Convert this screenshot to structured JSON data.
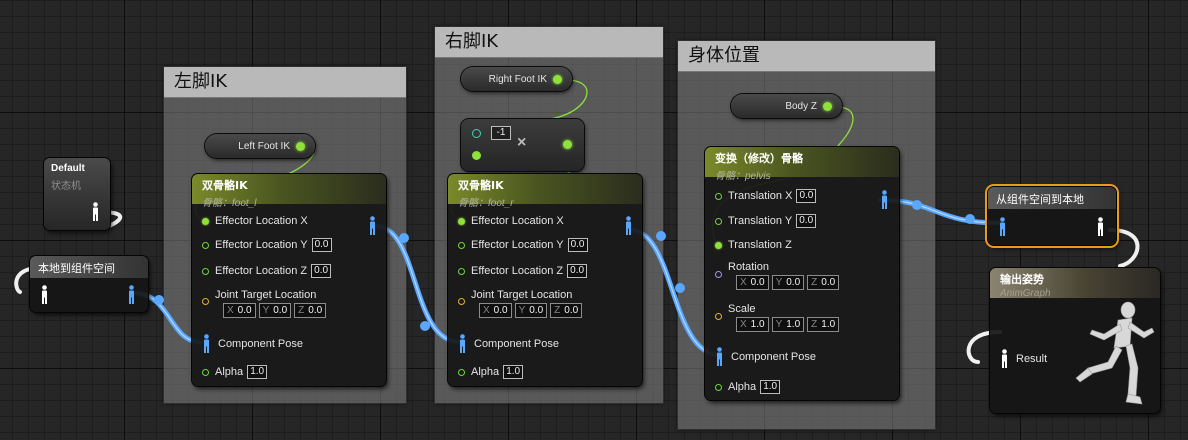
{
  "comments": [
    {
      "title": "左脚IK"
    },
    {
      "title": "右脚IK"
    },
    {
      "title": "身体位置"
    }
  ],
  "state_node": {
    "title": "Default",
    "subtitle": "状态机"
  },
  "local_to_component": {
    "title": "本地到组件空间"
  },
  "component_to_local": {
    "title": "从组件空间到本地"
  },
  "left_foot_get": {
    "label": "Left Foot IK"
  },
  "right_foot_get": {
    "label": "Right Foot IK"
  },
  "body_z_get": {
    "label": "Body Z"
  },
  "multiply": {
    "value": "-1",
    "icon": "multiply-icon"
  },
  "left_ik": {
    "title": "双骨骼IK",
    "subtitle": "骨骼：foot_l",
    "effector_x": "Effector Location X",
    "effector_y": "Effector Location Y",
    "effector_y_val": "0.0",
    "effector_z": "Effector Location Z",
    "effector_z_val": "0.0",
    "joint_target": "Joint Target Location",
    "jt": {
      "x": "0.0",
      "y": "0.0",
      "z": "0.0"
    },
    "component_pose": "Component Pose",
    "alpha": "Alpha",
    "alpha_val": "1.0"
  },
  "right_ik": {
    "title": "双骨骼IK",
    "subtitle": "骨骼：foot_r",
    "effector_x": "Effector Location X",
    "effector_y": "Effector Location Y",
    "effector_y_val": "0.0",
    "effector_z": "Effector Location Z",
    "effector_z_val": "0.0",
    "joint_target": "Joint Target Location",
    "jt": {
      "x": "0.0",
      "y": "0.0",
      "z": "0.0"
    },
    "component_pose": "Component Pose",
    "alpha": "Alpha",
    "alpha_val": "1.0"
  },
  "transform": {
    "title": "变换（修改）骨骼",
    "subtitle": "骨骼：pelvis",
    "tx": "Translation X",
    "tx_val": "0.0",
    "ty": "Translation Y",
    "ty_val": "0.0",
    "tz": "Translation Z",
    "rotation": "Rotation",
    "rot": {
      "x": "0.0",
      "y": "0.0",
      "z": "0.0"
    },
    "scale": "Scale",
    "scl": {
      "x": "1.0",
      "y": "1.0",
      "z": "1.0"
    },
    "component_pose": "Component Pose",
    "alpha": "Alpha",
    "alpha_val": "1.0"
  },
  "output_pose": {
    "title": "输出姿势",
    "subtitle": "AnimGraph",
    "result": "Result",
    "icon": "running-mannequin-icon"
  },
  "axis_labels": {
    "x": "X",
    "y": "Y",
    "z": "Z"
  },
  "colors": {
    "pose_wire": "#5aa7ff",
    "float_wire": "#8ee03a",
    "selection": "#e89c1a"
  }
}
